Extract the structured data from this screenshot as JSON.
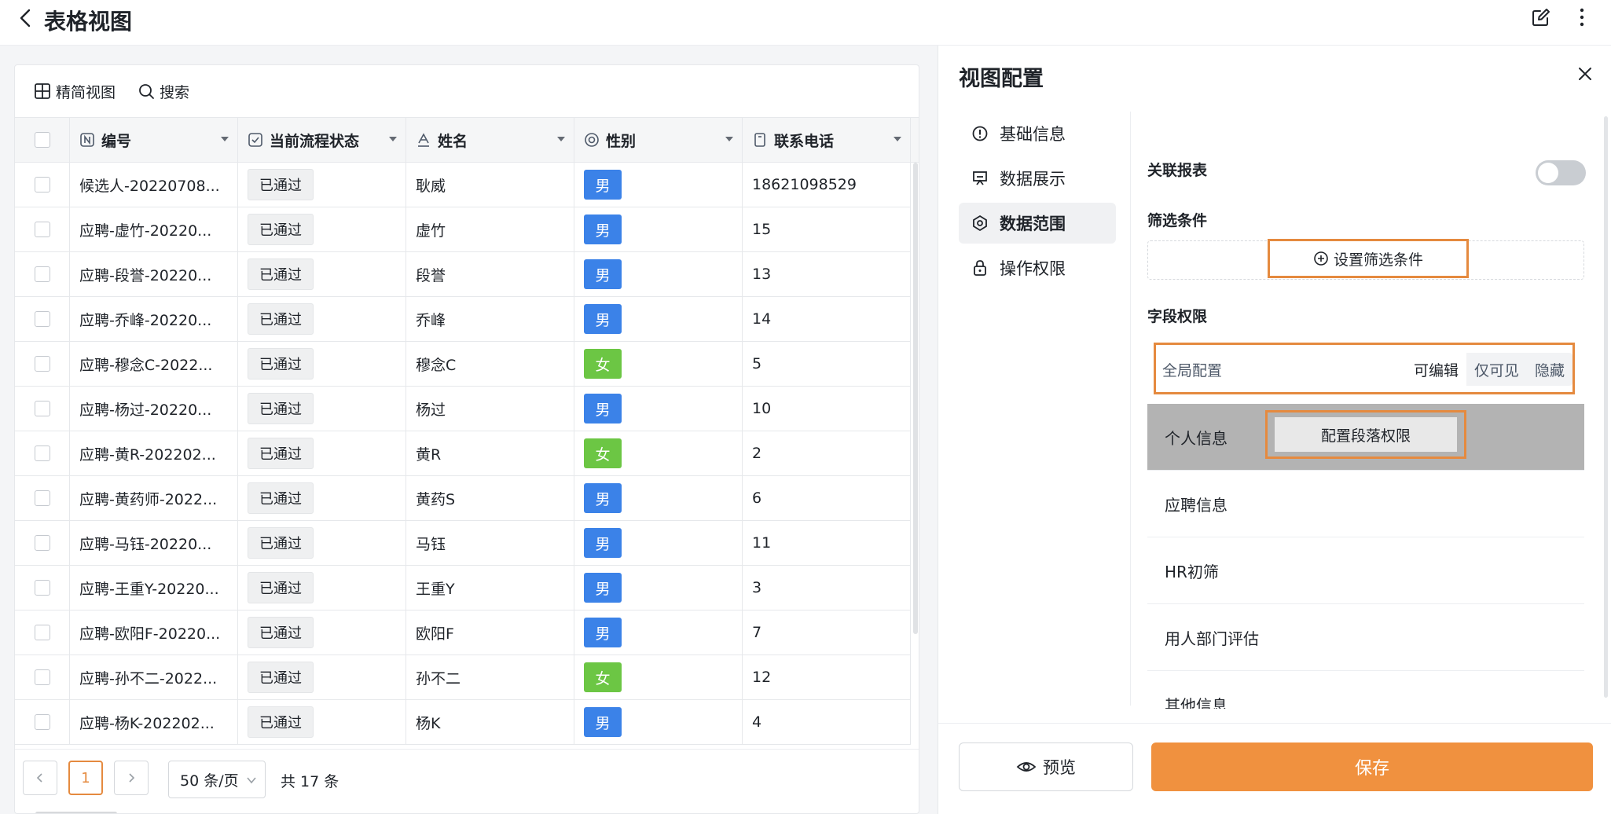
{
  "header": {
    "title": "表格视图"
  },
  "toolbar": {
    "simple_view_label": "精简视图",
    "search_label": "搜索"
  },
  "table": {
    "columns": [
      {
        "label": "编号",
        "icon": "text-field-icon"
      },
      {
        "label": "当前流程状态",
        "icon": "checkbox-field-icon"
      },
      {
        "label": "姓名",
        "icon": "text-a-icon"
      },
      {
        "label": "性别",
        "icon": "radio-field-icon"
      },
      {
        "label": "联系电话",
        "icon": "phone-field-icon"
      }
    ],
    "rows": [
      {
        "id": "候选人-20220708...",
        "status": "已通过",
        "name": "耿威",
        "gender": "男",
        "phone": "18621098529"
      },
      {
        "id": "应聘-虚竹-20220...",
        "status": "已通过",
        "name": "虚竹",
        "gender": "男",
        "phone": "15"
      },
      {
        "id": "应聘-段誉-20220...",
        "status": "已通过",
        "name": "段誉",
        "gender": "男",
        "phone": "13"
      },
      {
        "id": "应聘-乔峰-20220...",
        "status": "已通过",
        "name": "乔峰",
        "gender": "男",
        "phone": "14"
      },
      {
        "id": "应聘-穆念C-2022...",
        "status": "已通过",
        "name": "穆念C",
        "gender": "女",
        "phone": "5"
      },
      {
        "id": "应聘-杨过-20220...",
        "status": "已通过",
        "name": "杨过",
        "gender": "男",
        "phone": "10"
      },
      {
        "id": "应聘-黄R-202202...",
        "status": "已通过",
        "name": "黄R",
        "gender": "女",
        "phone": "2"
      },
      {
        "id": "应聘-黄药师-2022...",
        "status": "已通过",
        "name": "黄药S",
        "gender": "男",
        "phone": "6"
      },
      {
        "id": "应聘-马钰-20220...",
        "status": "已通过",
        "name": "马钰",
        "gender": "男",
        "phone": "11"
      },
      {
        "id": "应聘-王重Y-20220...",
        "status": "已通过",
        "name": "王重Y",
        "gender": "男",
        "phone": "3"
      },
      {
        "id": "应聘-欧阳F-20220...",
        "status": "已通过",
        "name": "欧阳F",
        "gender": "男",
        "phone": "7"
      },
      {
        "id": "应聘-孙不二-2022...",
        "status": "已通过",
        "name": "孙不二",
        "gender": "女",
        "phone": "12"
      },
      {
        "id": "应聘-杨K-202202...",
        "status": "已通过",
        "name": "杨K",
        "gender": "男",
        "phone": "4"
      }
    ]
  },
  "pagination": {
    "current_page": "1",
    "page_size": "50 条/页",
    "total": "共 17 条"
  },
  "panel": {
    "title": "视图配置",
    "nav": [
      {
        "label": "基础信息",
        "icon": "info-icon",
        "active": false
      },
      {
        "label": "数据展示",
        "icon": "display-icon",
        "active": false
      },
      {
        "label": "数据范围",
        "icon": "range-icon",
        "active": true
      },
      {
        "label": "操作权限",
        "icon": "lock-icon",
        "active": false
      }
    ],
    "linked_report_label": "关联报表",
    "linked_report_enabled": false,
    "filter_label": "筛选条件",
    "filter_button": "设置筛选条件",
    "field_perm_label": "字段权限",
    "global_config_label": "全局配置",
    "perm_options": [
      "可编辑",
      "仅可见",
      "隐藏"
    ],
    "perm_selected": "可编辑",
    "sections": [
      "个人信息",
      "应聘信息",
      "HR初筛",
      "用人部门评估",
      "其他信息"
    ],
    "section_button": "配置段落权限",
    "preview_button": "预览",
    "save_button": "保存"
  },
  "colors": {
    "accent": "#f0913f",
    "highlight_border": "#e58a3f",
    "male_tag": "#3b82e8",
    "female_tag": "#6cc644",
    "section_highlight": "#b3b3b3"
  }
}
